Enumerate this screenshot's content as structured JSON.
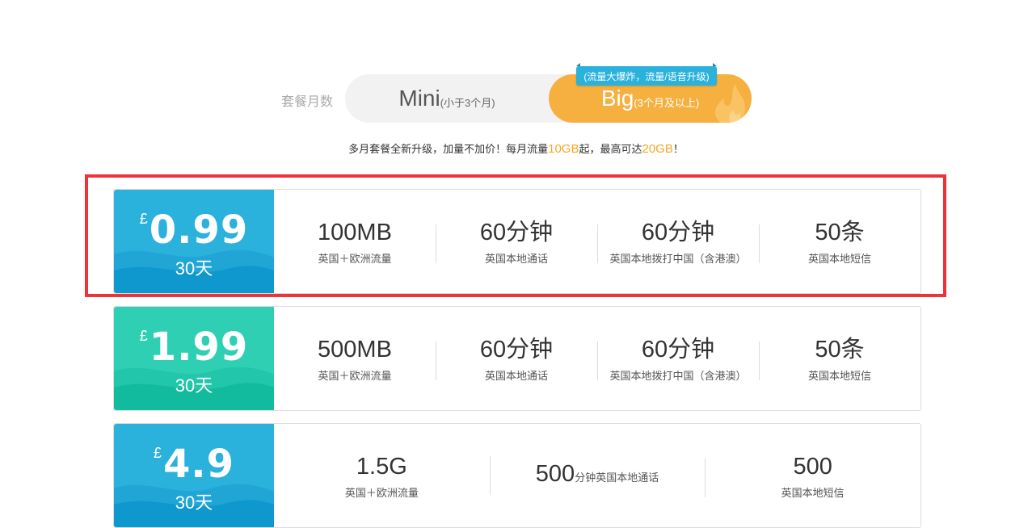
{
  "plan_toggle": {
    "label": "套餐月数",
    "mini": {
      "main": "Mini",
      "sub": "(小于3个月)"
    },
    "big": {
      "main": "Big",
      "sub": "(3个月及以上)"
    },
    "badge": "(流量大爆炸，流量/语音升级)",
    "selected": "big"
  },
  "promo": {
    "part1": "多月套餐全新升级，加量不加价！每月流量",
    "hl1": "10GB",
    "part2": "起，最高可达",
    "hl2": "20GB",
    "part3": "！"
  },
  "colors": {
    "accent_orange": "#f5b03f",
    "blue": "#2ab1dc",
    "teal": "#2fcfb3",
    "highlight_red": "#ee3238"
  },
  "cards": [
    {
      "currency": "£",
      "amount": "0.99",
      "days": "30天",
      "theme": "blue",
      "highlighted": true,
      "features": [
        {
          "value": "100MB",
          "desc": "英国＋欧洲流量"
        },
        {
          "value": "60分钟",
          "desc": "英国本地通话"
        },
        {
          "value": "60分钟",
          "desc": "英国本地拨打中国（含港澳）"
        },
        {
          "value": "50条",
          "desc": "英国本地短信"
        }
      ]
    },
    {
      "currency": "£",
      "amount": "1.99",
      "days": "30天",
      "theme": "teal",
      "highlighted": false,
      "features": [
        {
          "value": "500MB",
          "desc": "英国＋欧洲流量"
        },
        {
          "value": "60分钟",
          "desc": "英国本地通话"
        },
        {
          "value": "60分钟",
          "desc": "英国本地拨打中国（含港澳）"
        },
        {
          "value": "50条",
          "desc": "英国本地短信"
        }
      ]
    },
    {
      "currency": "£",
      "amount": "4.9",
      "days": "30天",
      "theme": "blue",
      "highlighted": false,
      "features": [
        {
          "value": "1.5G",
          "desc": "英国＋欧洲流量"
        },
        {
          "value": "500",
          "inline_desc": "分钟英国本地通话"
        },
        {
          "value": "500",
          "desc": "英国本地短信"
        }
      ]
    }
  ]
}
